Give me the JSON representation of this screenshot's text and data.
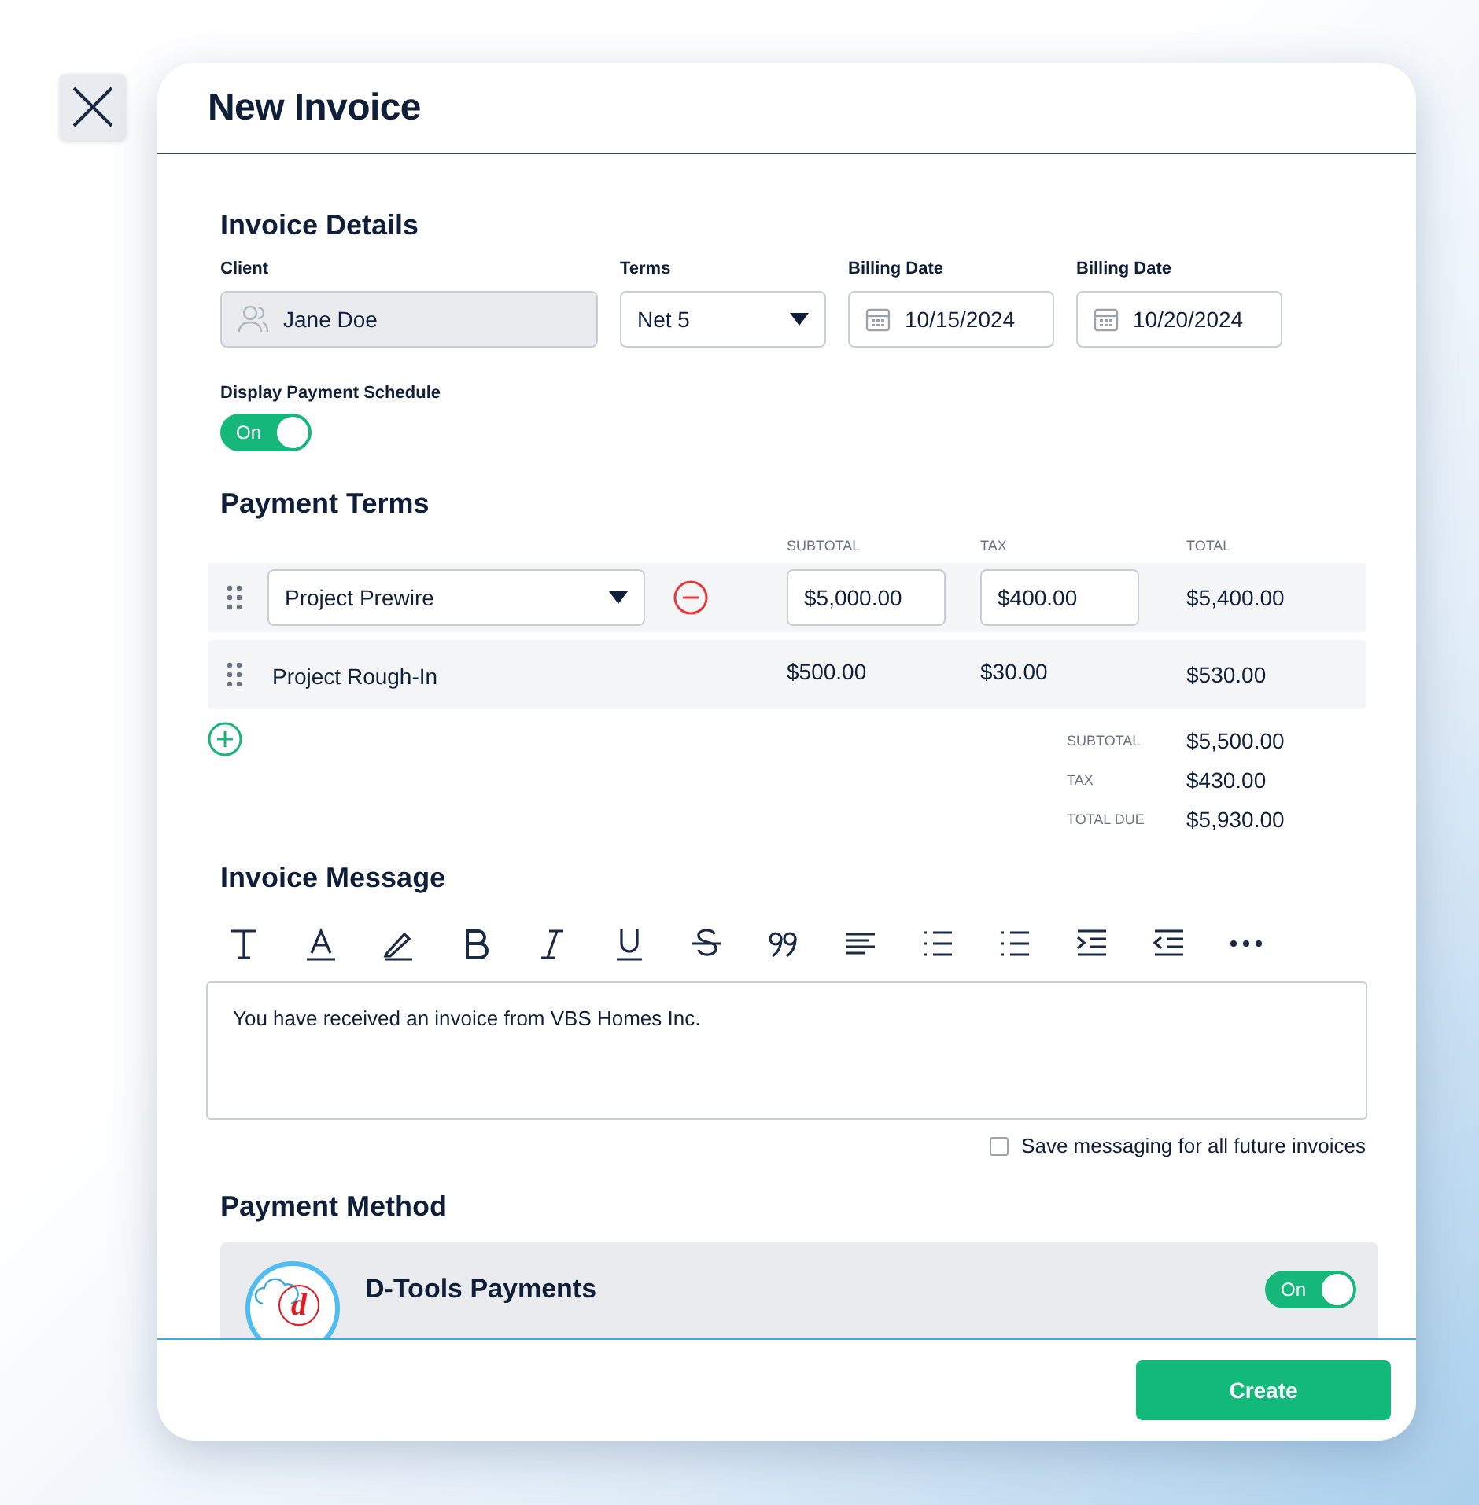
{
  "dialog": {
    "title": "New Invoice"
  },
  "invoice_details": {
    "heading": "Invoice Details",
    "client": {
      "label": "Client",
      "value": "Jane Doe",
      "disabled": true
    },
    "terms": {
      "label": "Terms",
      "value": "Net 5"
    },
    "dates": [
      {
        "label": "Billing Date",
        "value": "10/15/2024"
      },
      {
        "label": "Billing Date",
        "value": "10/20/2024"
      }
    ],
    "schedule": {
      "label": "Display Payment Schedule",
      "toggle_text": "On",
      "on": true
    }
  },
  "payment_terms": {
    "heading": "Payment Terms",
    "columns": [
      "SUBTOTAL",
      "TAX",
      "TOTAL"
    ],
    "rows": [
      {
        "kind": "editable",
        "name": "Project Prewire",
        "subtotal": "$5,000.00",
        "tax": "$400.00",
        "total": "$5,400.00"
      },
      {
        "kind": "static",
        "name": "Project Rough-In",
        "subtotal": "$500.00",
        "tax": "$30.00",
        "total": "$530.00"
      }
    ],
    "totals": [
      {
        "label": "SUBTOTAL",
        "value": "$5,500.00"
      },
      {
        "label": "TAX",
        "value": "$430.00"
      },
      {
        "label": "TOTAL DUE",
        "value": "$5,930.00"
      }
    ]
  },
  "invoice_message": {
    "heading": "Invoice Message",
    "text": "You have received an invoice from VBS Homes Inc.",
    "save_label": "Save messaging for all future invoices",
    "save_checked": false
  },
  "payment_method": {
    "heading": "Payment Method",
    "logo_letter": "d",
    "name": "D-Tools Payments",
    "toggle_text": "On",
    "on": true
  },
  "footer": {
    "button": "Create"
  }
}
